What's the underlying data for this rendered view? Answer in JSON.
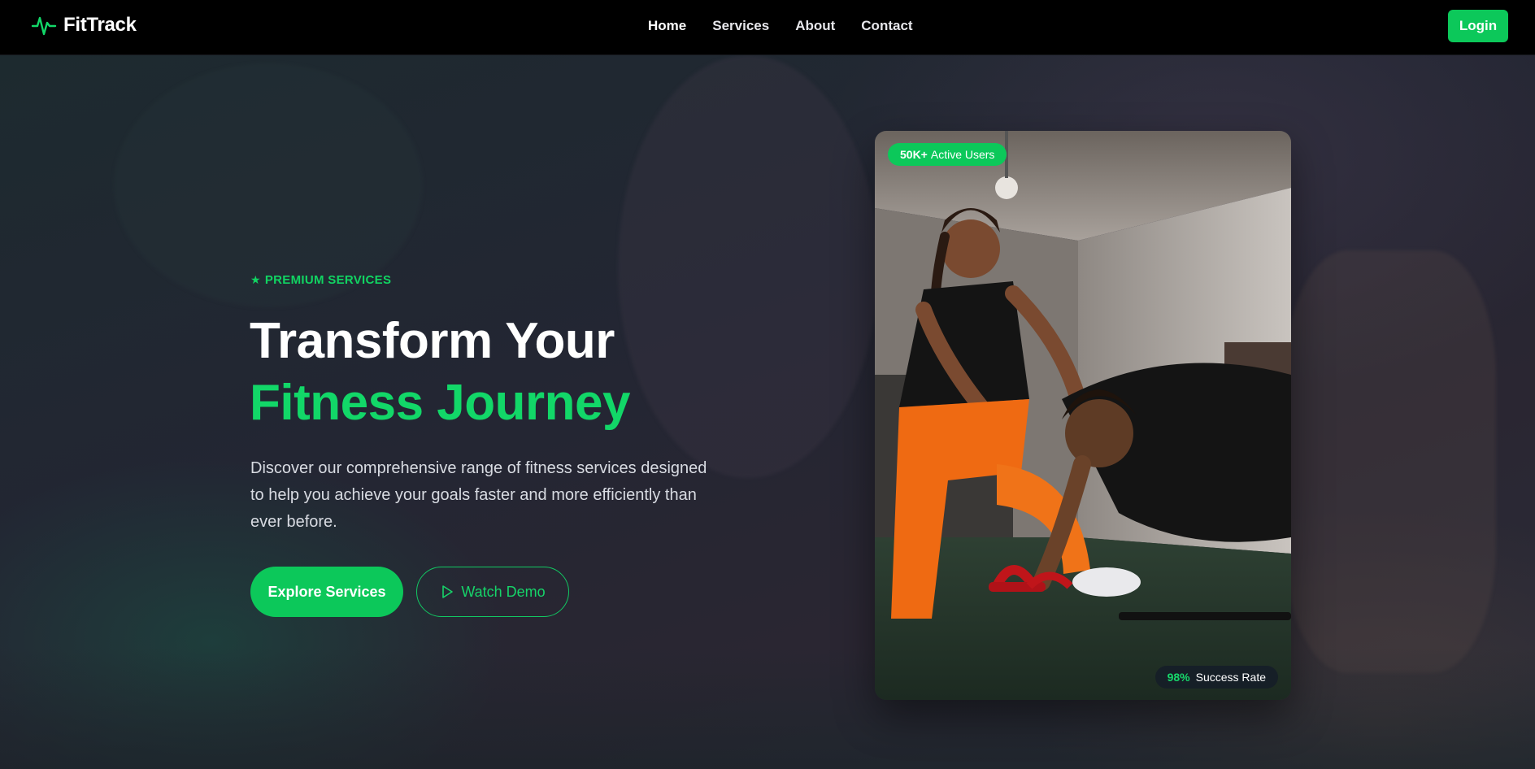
{
  "nav": {
    "brand": "FitTrack",
    "links": [
      "Home",
      "Services",
      "About",
      "Contact"
    ],
    "login": "Login"
  },
  "hero": {
    "eyebrow": "PREMIUM SERVICES",
    "headline_line1": "Transform Your",
    "headline_line2": "Fitness Journey",
    "description": "Discover our comprehensive range of fitness services designed to help you achieve your goals faster and more efficiently than ever before.",
    "primary_cta": "Explore Services",
    "secondary_cta": "Watch Demo"
  },
  "card": {
    "users_value": "50K+",
    "users_label": "Active Users",
    "rate_value": "98%",
    "rate_label": "Success Rate"
  },
  "colors": {
    "accent": "#0cc85a",
    "nav_bg": "#000000"
  }
}
